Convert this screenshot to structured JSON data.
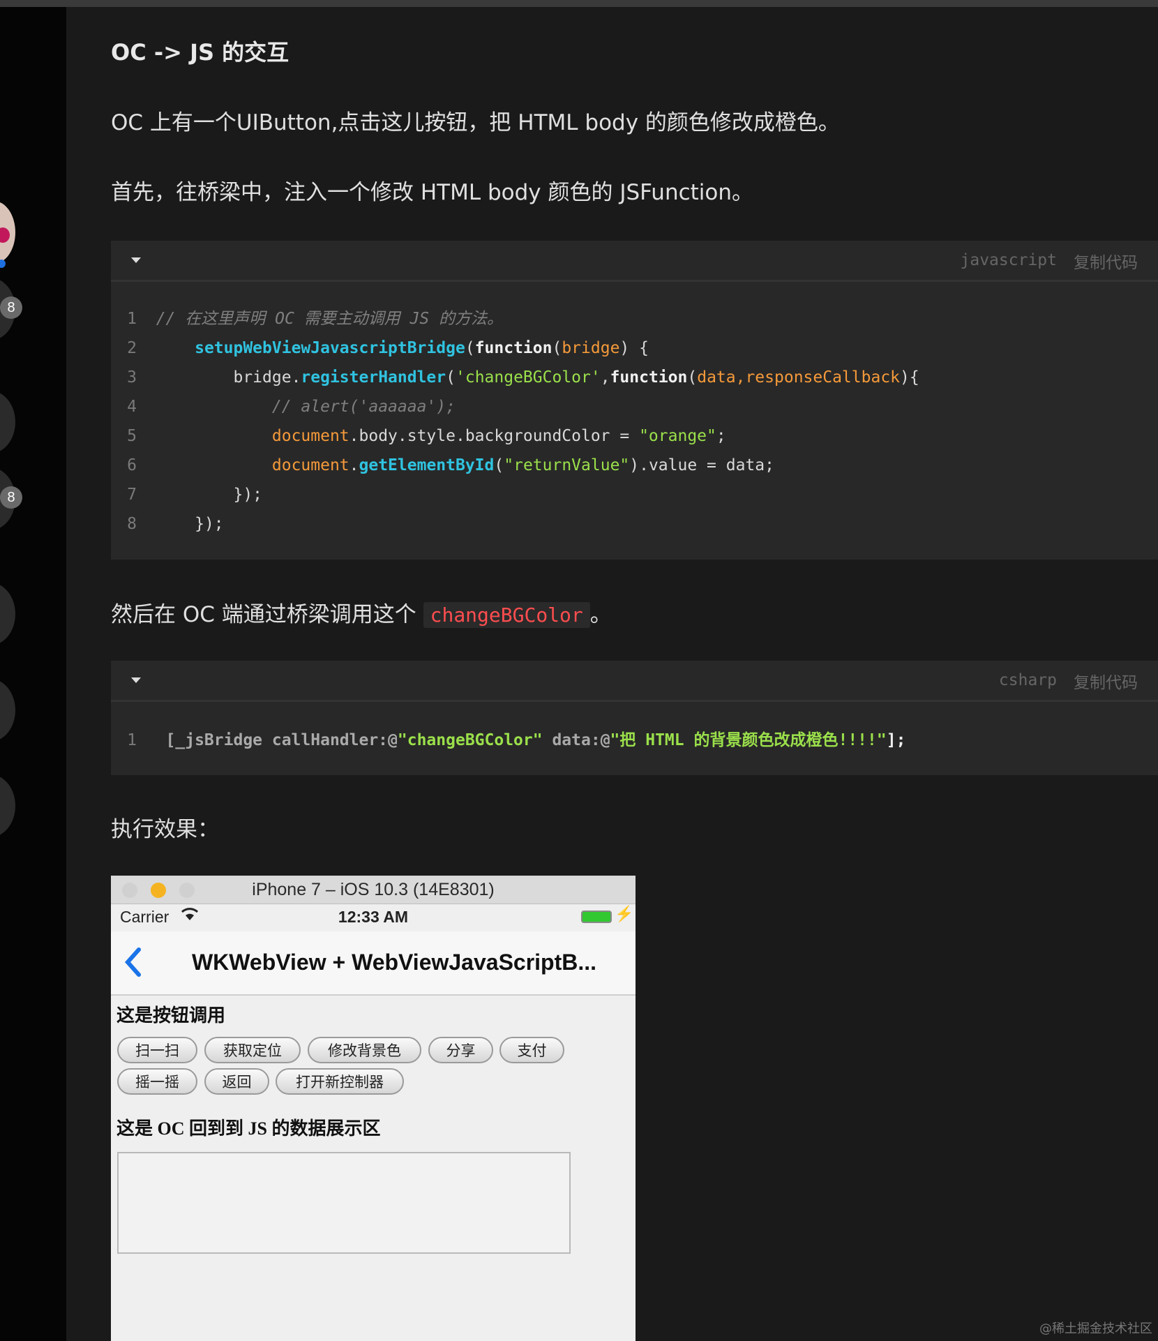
{
  "article": {
    "heading": "OC -> JS 的交互",
    "para1": "OC 上有一个UIButton,点击这儿按钮，把 HTML body 的颜色修改成橙色。",
    "para2": "首先，往桥梁中，注入一个修改 HTML body 颜色的 JSFunction。",
    "para3_before": "然后在 OC 端通过桥梁调用这个 ",
    "para3_code": "changeBGColor",
    "para3_after": "。",
    "para4": "执行效果："
  },
  "sidebar": {
    "badge1": "8",
    "badge2": "8"
  },
  "code1": {
    "lang": "javascript",
    "copy": "复制代码",
    "lines": [
      {
        "n": "1",
        "t1": "// 在这里声明 OC 需要主动调用 JS 的方法。"
      },
      {
        "n": "2",
        "fn": "setupWebViewJavascriptBridge",
        "p1": "(",
        "kw": "function",
        "p2": "(",
        "pm": "bridge",
        "p3": ") {"
      },
      {
        "n": "3",
        "a": "bridge.",
        "fn": "registerHandler",
        "p1": "(",
        "str": "'changeBGColor'",
        "p2": ",",
        "kw": "function",
        "p3": "(",
        "pm": "data,responseCallback",
        "p4": "){"
      },
      {
        "n": "4",
        "t1": "// alert('aaaaaa');"
      },
      {
        "n": "5",
        "pm": "document",
        ".a": ".body.style.backgroundColor = ",
        "str": "\"orange\"",
        "end": ";"
      },
      {
        "n": "6",
        "pm": "document",
        "a": ".",
        "fn": "getElementById",
        "p1": "(",
        "str": "\"returnValue\"",
        "end": ").value = data;"
      },
      {
        "n": "7",
        "t1": "});"
      },
      {
        "n": "8",
        "t1": "});"
      }
    ]
  },
  "code2": {
    "lang": "csharp",
    "copy": "复制代码",
    "line": {
      "n": "1",
      "a": "[_jsBridge callHandler:@",
      "s1": "\"changeBGColor\"",
      "b": " data:@",
      "s2": "\"把 HTML 的背景颜色改成橙色!!!!\"",
      "end": "];"
    }
  },
  "simulator": {
    "window_title": "iPhone 7 – iOS 10.3 (14E8301)",
    "carrier": "Carrier",
    "time": "12:33 AM",
    "nav_title": "WKWebView + WebViewJavaScriptB...",
    "back": "<",
    "section1": "这是按钮调用",
    "buttons": [
      "扫一扫",
      "获取定位",
      "修改背景色",
      "分享",
      "支付",
      "摇一摇",
      "返回",
      "打开新控制器"
    ],
    "section2": "这是 OC 回到到 JS 的数据展示区",
    "colors": {
      "close": "#d0d0d0",
      "minimize": "#f5b321",
      "zoom": "#d0d0d0",
      "battery": "#32c832",
      "back": "#1a73e8"
    }
  },
  "watermark": "@稀土掘金技术社区"
}
